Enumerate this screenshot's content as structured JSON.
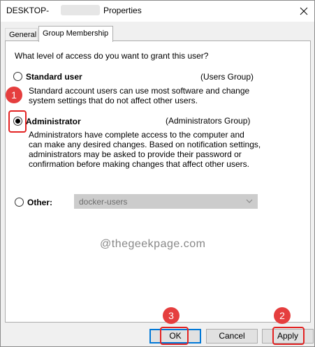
{
  "window": {
    "title_prefix": "DESKTOP-",
    "title_suffix": "Properties",
    "close_glyph": "✕"
  },
  "tabs": [
    {
      "label": "General",
      "active": false
    },
    {
      "label": "Group Membership",
      "active": true
    }
  ],
  "panel": {
    "question": "What level of access do you want to grant this user?",
    "options": [
      {
        "label": "Standard user",
        "group": "(Users Group)",
        "checked": false,
        "description": [
          "Standard account users can use most software and change",
          "system settings that do not affect other users."
        ]
      },
      {
        "label": "Administrator",
        "group": "(Administrators Group)",
        "checked": true,
        "description": [
          "Administrators have complete access to the computer and",
          "can make any desired changes. Based on notification settings,",
          "administrators may be asked to provide their password or",
          "confirmation before making changes that affect other users."
        ]
      },
      {
        "label": "Other:",
        "checked": false,
        "dropdown_value": "docker-users"
      }
    ],
    "watermark": "@thegeekpage.com"
  },
  "buttons": {
    "ok": "OK",
    "cancel": "Cancel",
    "apply": "Apply"
  },
  "annotations": {
    "step1": "1",
    "step2": "2",
    "step3": "3",
    "color": "#e32323"
  },
  "colors": {
    "window_bg": "#f0f0f0",
    "panel_bg": "#ffffff",
    "focus_border": "#0078d7",
    "highlight": "#e32323"
  }
}
